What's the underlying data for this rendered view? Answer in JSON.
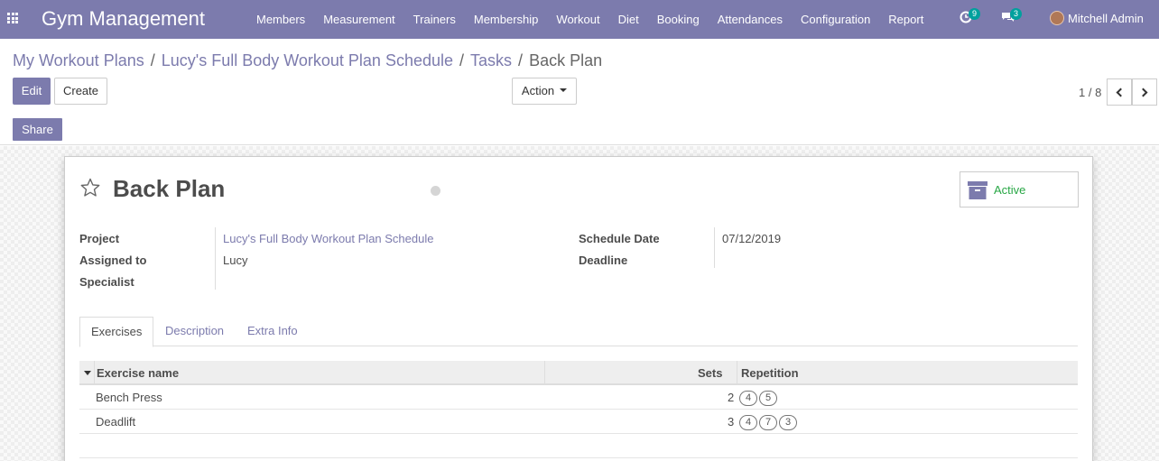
{
  "navbar": {
    "brand": "Gym Management",
    "menu": [
      "Members",
      "Measurement",
      "Trainers",
      "Membership",
      "Workout",
      "Diet",
      "Booking",
      "Attendances",
      "Configuration",
      "Report"
    ],
    "activity_count": "9",
    "messages_count": "3",
    "user_name": "Mitchell Admin"
  },
  "breadcrumb": {
    "items": [
      "My Workout Plans",
      "Lucy's Full Body Workout Plan Schedule",
      "Tasks"
    ],
    "separator": "/",
    "current": "Back Plan"
  },
  "buttons": {
    "edit": "Edit",
    "create": "Create",
    "action": "Action",
    "share": "Share"
  },
  "pager": {
    "value": "1 / 8"
  },
  "record": {
    "title": "Back Plan",
    "active_label": "Active",
    "fields": {
      "project_label": "Project",
      "project_value": "Lucy's Full Body Workout Plan Schedule",
      "assigned_label": "Assigned to",
      "assigned_value": "Lucy",
      "specialist_label": "Specialist",
      "schedule_date_label": "Schedule Date",
      "schedule_date_value": "07/12/2019",
      "deadline_label": "Deadline"
    }
  },
  "tabs": [
    "Exercises",
    "Description",
    "Extra Info"
  ],
  "exercises_table": {
    "columns": [
      "Exercise name",
      "Sets",
      "Repetition"
    ],
    "rows": [
      {
        "name": "Bench Press",
        "sets": "2",
        "repetition": [
          "4",
          "5"
        ]
      },
      {
        "name": "Deadlift",
        "sets": "3",
        "repetition": [
          "4",
          "7",
          "3"
        ]
      }
    ]
  },
  "colors": {
    "brand": "#7c7bad",
    "badge": "#00a09d",
    "active_green": "#28a745"
  },
  "icons": [
    "apps-grid-icon",
    "activity-clock-icon",
    "chat-bubbles-icon",
    "star-outline-icon",
    "archive-box-icon",
    "chevron-left-icon",
    "chevron-right-icon",
    "caret-down-icon"
  ]
}
